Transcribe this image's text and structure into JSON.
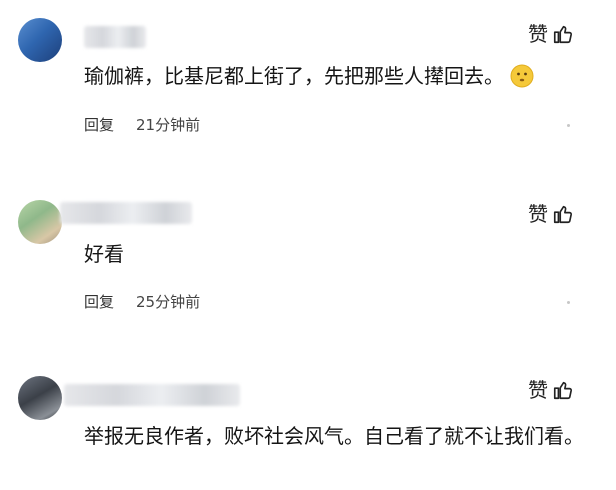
{
  "like_label": "赞",
  "reply_label": "回复",
  "comments": [
    {
      "text": "瑜伽裤，比基尼都上街了，先把那些人撵回去。",
      "time": "21分钟前",
      "emoji": "emoji-icon"
    },
    {
      "text": "好看",
      "time": "25分钟前"
    },
    {
      "text": "举报无良作者，败坏社会风气。自己看了就不让我们看。"
    }
  ]
}
